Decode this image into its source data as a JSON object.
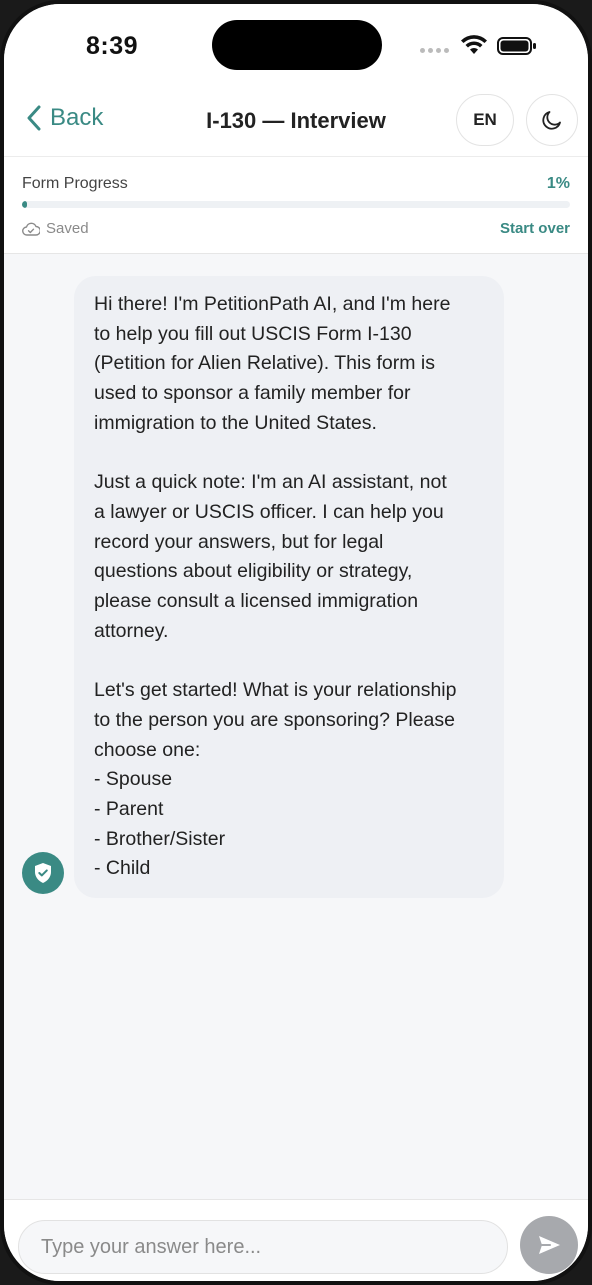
{
  "status_bar": {
    "time": "8:39"
  },
  "header": {
    "back_label": "Back",
    "title": "I-130 — Interview",
    "language_label": "EN"
  },
  "progress": {
    "label": "Form Progress",
    "value_text": "1%",
    "value": 0.01,
    "saved_label": "Saved",
    "start_over_label": "Start over"
  },
  "chat": {
    "message": {
      "para1": [
        "Hi there! I'm PetitionPath AI, and I'm here",
        "to help you fill out USCIS Form I-130",
        "(Petition for Alien Relative). This form is",
        "used to sponsor a family member for",
        "immigration to the United States."
      ],
      "para2": [
        "Just a quick note: I'm an AI assistant, not",
        "a lawyer or USCIS officer. I can help you",
        "record your answers, but for legal",
        "questions about eligibility or strategy,",
        "please consult a licensed immigration",
        "attorney."
      ],
      "para3": [
        "Let's get started! What is your relationship",
        "to the person you are sponsoring? Please",
        "choose one:",
        "- Spouse",
        "- Parent",
        "- Brother/Sister",
        "- Child"
      ]
    }
  },
  "input": {
    "placeholder": "Type your answer here..."
  },
  "colors": {
    "accent": "#3a8a84",
    "bubble": "#eef0f4",
    "background": "#f6f7f9"
  }
}
